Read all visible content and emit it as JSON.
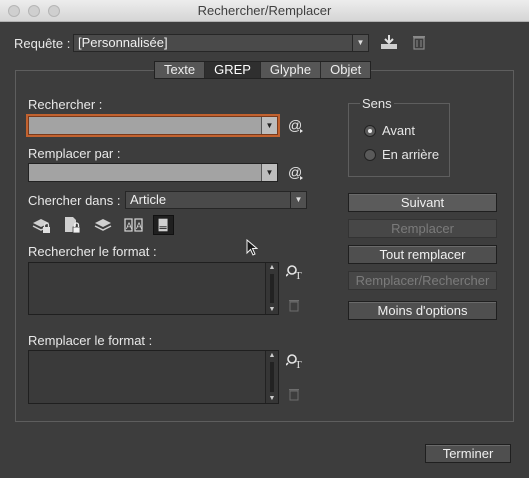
{
  "window": {
    "title": "Rechercher/Remplacer"
  },
  "query": {
    "label": "Requête :",
    "value": "[Personnalisée]"
  },
  "tabs": [
    "Texte",
    "GREP",
    "Glyphe",
    "Objet"
  ],
  "active_tab": "GREP",
  "find": {
    "label": "Rechercher :",
    "value": ""
  },
  "replace": {
    "label": "Remplacer par :",
    "value": ""
  },
  "search_in": {
    "label": "Chercher dans :",
    "value": "Article"
  },
  "find_format": {
    "label": "Rechercher le format :"
  },
  "replace_format": {
    "label": "Remplacer le format :"
  },
  "direction": {
    "title": "Sens",
    "options": [
      "Avant",
      "En arrière"
    ],
    "selected": "Avant"
  },
  "buttons": {
    "next": "Suivant",
    "replace": "Remplacer",
    "replace_all": "Tout remplacer",
    "replace_find": "Remplacer/Rechercher",
    "fewer_options": "Moins d'options",
    "done": "Terminer"
  },
  "colors": {
    "focus_ring": "#c2622f",
    "window_bg": "#3d3d3d"
  }
}
